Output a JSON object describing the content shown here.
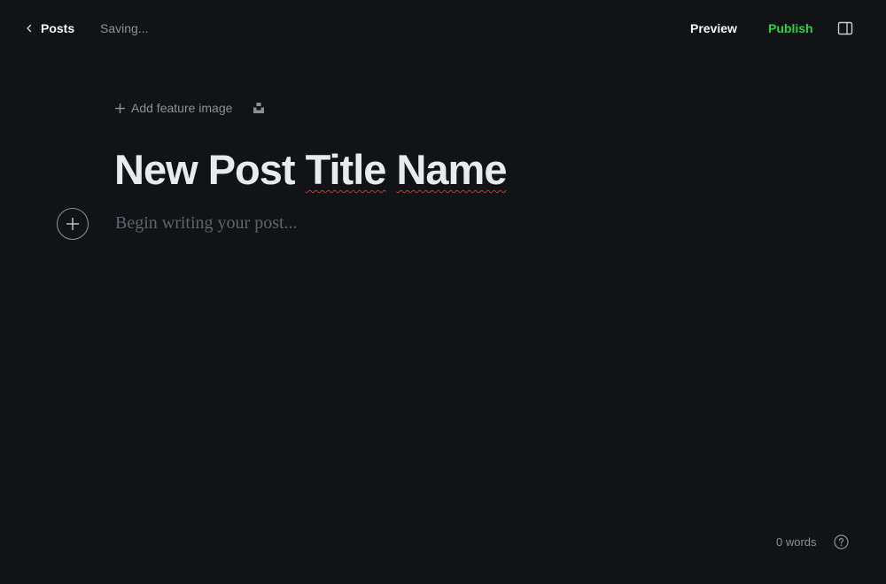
{
  "topbar": {
    "back_label": "Posts",
    "status": "Saving...",
    "preview_label": "Preview",
    "publish_label": "Publish"
  },
  "icons": {
    "back": "chevron-left-icon",
    "sidebar_toggle": "sidebar-toggle-icon",
    "add": "plus-icon",
    "unsplash": "unsplash-icon",
    "help": "help-icon"
  },
  "colors": {
    "background": "#121317",
    "publish": "#30cf43",
    "muted": "#8b9097"
  },
  "editor": {
    "add_feature_image_label": "Add feature image",
    "title_words": [
      "New",
      "Post",
      "Title",
      "Name"
    ],
    "body_placeholder": "Begin writing your post..."
  },
  "footer": {
    "word_count": "0 words"
  }
}
